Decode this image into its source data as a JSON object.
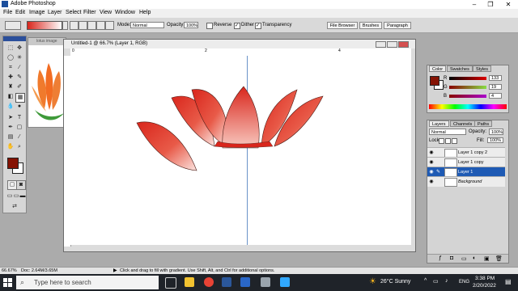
{
  "app": {
    "title": "Adobe Photoshop"
  },
  "menu": [
    "File",
    "Edit",
    "Image",
    "Layer",
    "Select",
    "Filter",
    "View",
    "Window",
    "Help"
  ],
  "options": {
    "mode_label": "Mode:",
    "mode_value": "Normal",
    "opacity_label": "Opacity:",
    "opacity_value": "100%",
    "reverse_label": "Reverse",
    "dither_label": "Dither",
    "transparency_label": "Transparency",
    "gradient_start": "#d9261c",
    "gradient_end": "#ffffff"
  },
  "palette_tabs": [
    "File Browser",
    "Brushes",
    "Paragraph"
  ],
  "document": {
    "background_title": "lotus image",
    "title": "Untitled-1 @ 66.7% (Layer 1, RGB)",
    "ruler_marks": [
      "0",
      "2",
      "4",
      "6",
      "8"
    ]
  },
  "color_panel": {
    "tabs": [
      "Color",
      "Swatches",
      "Styles"
    ],
    "sliders": [
      {
        "label": "R",
        "value": "133"
      },
      {
        "label": "G",
        "value": "19"
      },
      {
        "label": "B",
        "value": "4"
      }
    ],
    "foreground": "#851304"
  },
  "layers_panel": {
    "tabs": [
      "Layers",
      "Channels",
      "Paths"
    ],
    "blend_mode": "Normal",
    "opacity_label": "Opacity:",
    "opacity_value": "100%",
    "lock_label": "Lock:",
    "fill_label": "Fill:",
    "fill_value": "100%",
    "layers": [
      {
        "name": "Layer 1 copy 2",
        "selected": false
      },
      {
        "name": "Layer 1 copy",
        "selected": false
      },
      {
        "name": "Layer 1",
        "selected": true
      },
      {
        "name": "Background",
        "selected": false
      }
    ]
  },
  "status": {
    "zoom": "66.67%",
    "doc": "Doc: 2.64M/3.65M",
    "hint": "Click and drag to fill with gradient. Use Shift, Alt, and Ctrl for additional options."
  },
  "taskbar": {
    "search_placeholder": "Type here to search",
    "weather": "26°C  Sunny",
    "lang": "ENG",
    "time": "3:38 PM",
    "date": "2/20/2022"
  }
}
